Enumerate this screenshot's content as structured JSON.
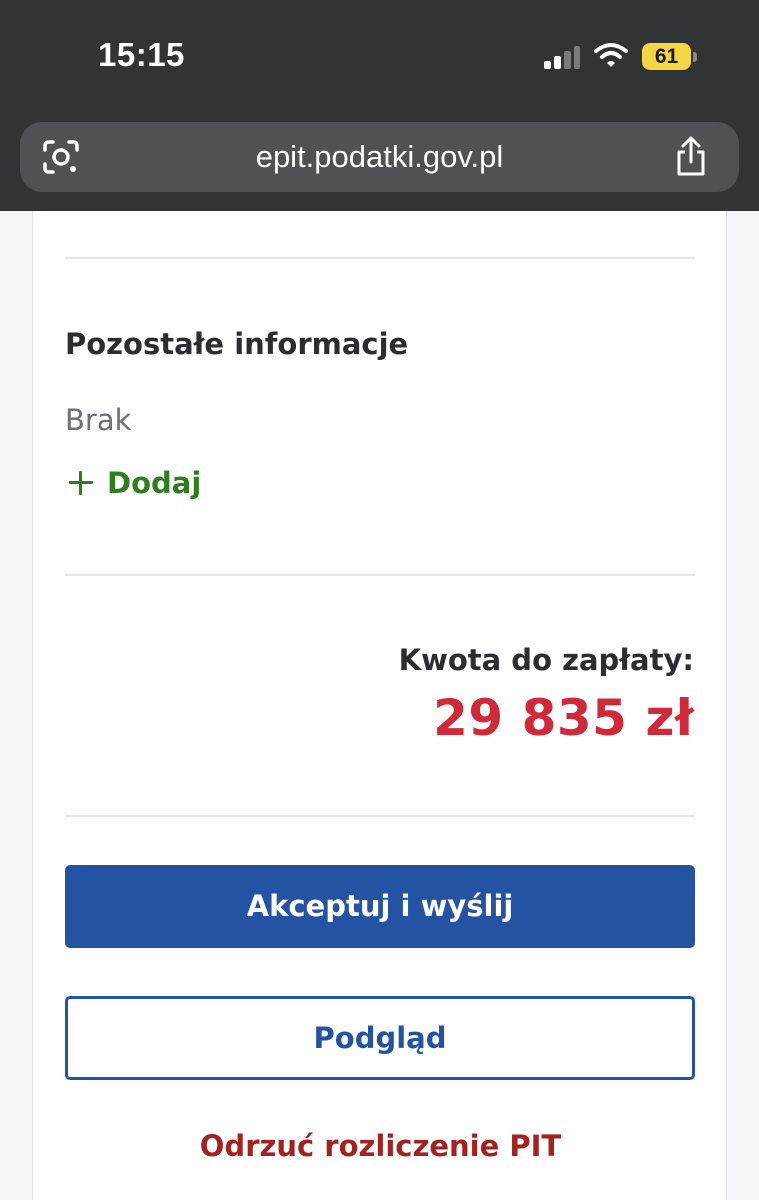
{
  "status_bar": {
    "time": "15:15",
    "battery": "61"
  },
  "browser": {
    "url": "epit.podatki.gov.pl"
  },
  "other_info": {
    "title": "Pozostałe informacje",
    "empty_text": "Brak",
    "add_label": "Dodaj"
  },
  "summary": {
    "amount_label": "Kwota do zapłaty:",
    "amount_value": "29 835 zł"
  },
  "actions": {
    "accept_label": "Akceptuj i wyślij",
    "preview_label": "Podgląd",
    "reject_label": "Odrzuć rozliczenie PIT"
  },
  "colors": {
    "primary": "#2453a4",
    "amount": "#d02a3a",
    "add_link": "#2e7d1f",
    "reject": "#a3221f"
  }
}
